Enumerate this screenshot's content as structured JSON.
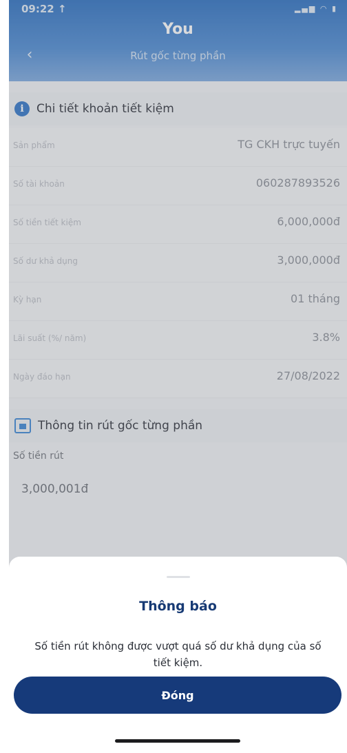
{
  "status_bar": {
    "time": "09:22 ↑",
    "icons": "▂▄▆ ◠ ▮"
  },
  "header": {
    "title": "You",
    "subtitle": "Rút gốc từng phần"
  },
  "savings_section": {
    "title": "Chi tiết khoản tiết kiệm",
    "rows": [
      {
        "label": "Sản phẩm",
        "value": "TG CKH trực tuyến"
      },
      {
        "label": "Số tài khoản",
        "value": "060287893526"
      },
      {
        "label": "Số tiền tiết kiệm",
        "value": "6,000,000đ"
      },
      {
        "label": "Số dư khả dụng",
        "value": "3,000,000đ"
      },
      {
        "label": "Kỳ hạn",
        "value": "01 tháng"
      },
      {
        "label": "Lãi suất (%/ năm)",
        "value": "3.8%"
      },
      {
        "label": "Ngày đáo hạn",
        "value": "27/08/2022"
      }
    ]
  },
  "withdraw_section": {
    "title": "Thông tin rút gốc từng phần",
    "amount_label": "Số tiền rút",
    "amount_value": "3,000,001đ"
  },
  "dialog": {
    "title": "Thông báo",
    "message": "Số tiền rút không được vượt quá số dư khả dụng của số tiết kiệm.",
    "close_label": "Đóng"
  },
  "colors": {
    "header": "#2b6fc0",
    "button": "#163a7a",
    "dialog_title": "#173a74"
  }
}
